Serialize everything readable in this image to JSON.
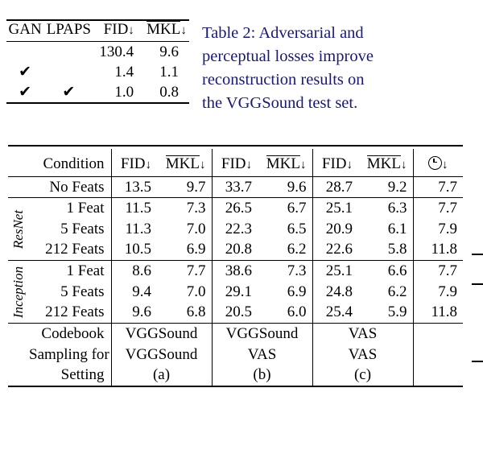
{
  "caption": {
    "label": "Table 2:",
    "lines": [
      [
        "Table 2:",
        "Adversarial",
        "and"
      ],
      [
        "perceptual",
        "losses",
        "improve"
      ],
      [
        "reconstruction",
        "results",
        "on"
      ]
    ],
    "last_line": "the VGGSound test set.",
    "full_text": "Table 2: Adversarial and perceptual losses improve reconstruction results on the VGGSound test set.",
    "color": "#181878"
  },
  "table1": {
    "headers": [
      "GAN",
      "LPAPS",
      "FID↓",
      "MKL↓"
    ],
    "header_plain": [
      "GAN",
      "LPAPS",
      "FID",
      "MKL"
    ],
    "arrow": "↓",
    "check_glyph": "✔",
    "rows": [
      {
        "gan": "",
        "lpaps": "",
        "fid": "130.4",
        "mkl": "9.6"
      },
      {
        "gan": "✔",
        "lpaps": "",
        "fid": "1.4",
        "mkl": "1.1"
      },
      {
        "gan": "✔",
        "lpaps": "✔",
        "fid": "1.0",
        "mkl": "0.8"
      }
    ]
  },
  "table2": {
    "headers": {
      "condition": "Condition",
      "fid": "FID",
      "mkl": "MKL",
      "arrow": "↓",
      "time_icon": "clock-icon",
      "time_label": "⊙↓"
    },
    "group_labels": [
      "ResNet",
      "Inception"
    ],
    "no_feats_row": {
      "condition": "No Feats",
      "a_fid": "13.5",
      "a_mkl": "9.7",
      "b_fid": "33.7",
      "b_mkl": "9.6",
      "c_fid": "28.7",
      "c_mkl": "9.2",
      "time": "7.7"
    },
    "resnet_rows": [
      {
        "condition": "1 Feat",
        "a_fid": "11.5",
        "a_mkl": "7.3",
        "b_fid": "26.5",
        "b_mkl": "6.7",
        "c_fid": "25.1",
        "c_mkl": "6.3",
        "time": "7.7"
      },
      {
        "condition": "5 Feats",
        "a_fid": "11.3",
        "a_mkl": "7.0",
        "b_fid": "22.3",
        "b_mkl": "6.5",
        "c_fid": "20.9",
        "c_mkl": "6.1",
        "time": "7.9"
      },
      {
        "condition": "212 Feats",
        "a_fid": "10.5",
        "a_mkl": "6.9",
        "b_fid": "20.8",
        "b_mkl": "6.2",
        "c_fid": "22.6",
        "c_mkl": "5.8",
        "time": "11.8"
      }
    ],
    "inception_rows": [
      {
        "condition": "1 Feat",
        "a_fid": "8.6",
        "a_mkl": "7.7",
        "b_fid": "38.6",
        "b_mkl": "7.3",
        "c_fid": "25.1",
        "c_mkl": "6.6",
        "time": "7.7"
      },
      {
        "condition": "5 Feats",
        "a_fid": "9.4",
        "a_mkl": "7.0",
        "b_fid": "29.1",
        "b_mkl": "6.9",
        "c_fid": "24.8",
        "c_mkl": "6.2",
        "time": "7.9"
      },
      {
        "condition": "212 Feats",
        "a_fid": "9.6",
        "a_mkl": "6.8",
        "b_fid": "20.5",
        "b_mkl": "6.0",
        "c_fid": "25.4",
        "c_mkl": "5.9",
        "time": "11.8"
      }
    ],
    "footer": {
      "labels": [
        "Codebook",
        "Sampling for",
        "Setting"
      ],
      "col_a": [
        "VGGSound",
        "VGGSound",
        "(a)"
      ],
      "col_b": [
        "VGGSound",
        "VAS",
        "(b)"
      ],
      "col_c": [
        "VAS",
        "VAS",
        "(c)"
      ]
    }
  }
}
